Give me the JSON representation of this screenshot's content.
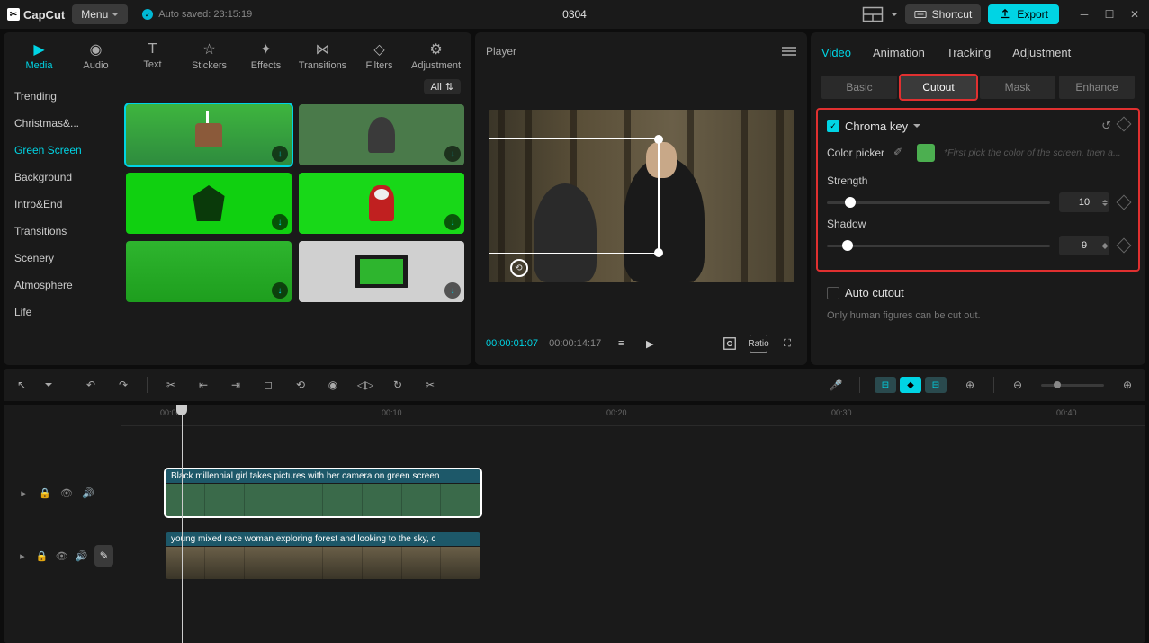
{
  "app": {
    "name": "CapCut",
    "menu": "Menu",
    "autosave": "Auto saved: 23:15:19",
    "title": "0304",
    "shortcut": "Shortcut",
    "export": "Export"
  },
  "tabs": {
    "media": "Media",
    "audio": "Audio",
    "text": "Text",
    "stickers": "Stickers",
    "effects": "Effects",
    "transitions": "Transitions",
    "filters": "Filters",
    "adjustment": "Adjustment"
  },
  "categories": [
    "Trending",
    "Christmas&...",
    "Green Screen",
    "Background",
    "Intro&End",
    "Transitions",
    "Scenery",
    "Atmosphere",
    "Life"
  ],
  "filter_all": "All",
  "player": {
    "label": "Player",
    "current": "00:00:01:07",
    "total": "00:00:14:17",
    "ratio": "Ratio"
  },
  "right": {
    "tabs": {
      "video": "Video",
      "animation": "Animation",
      "tracking": "Tracking",
      "adjustment": "Adjustment"
    },
    "subtabs": {
      "basic": "Basic",
      "cutout": "Cutout",
      "mask": "Mask",
      "enhance": "Enhance"
    },
    "chroma": {
      "title": "Chroma key",
      "picker": "Color picker",
      "hint": "*First pick the color of the screen, then a...",
      "strength": "Strength",
      "strength_val": "10",
      "shadow": "Shadow",
      "shadow_val": "9"
    },
    "autocut": {
      "title": "Auto cutout",
      "hint": "Only human figures can be cut out."
    }
  },
  "ruler": [
    "00:00",
    "00:10",
    "00:20",
    "00:30",
    "00:40"
  ],
  "clips": {
    "c1": "Black millennial girl takes pictures with her camera on green screen",
    "c2": "young mixed race woman exploring forest and looking to the sky, c"
  }
}
